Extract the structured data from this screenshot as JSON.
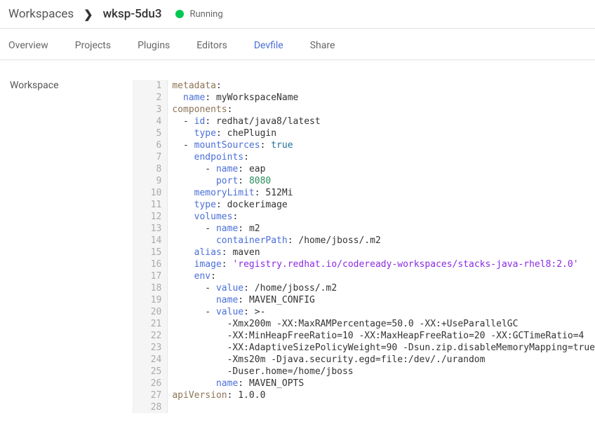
{
  "header": {
    "title": "Workspaces",
    "chevron": "❯",
    "workspace_id": "wksp-5du3",
    "status": "Running"
  },
  "tabs": [
    {
      "label": "Overview",
      "active": false
    },
    {
      "label": "Projects",
      "active": false
    },
    {
      "label": "Plugins",
      "active": false
    },
    {
      "label": "Editors",
      "active": false
    },
    {
      "label": "Devfile",
      "active": true
    },
    {
      "label": "Share",
      "active": false
    }
  ],
  "sidebar": {
    "label": "Workspace"
  },
  "code": {
    "lines": [
      [
        {
          "t": "key",
          "v": "metadata"
        },
        {
          "t": "punct",
          "v": ":"
        }
      ],
      [
        {
          "t": "plain",
          "v": "  "
        },
        {
          "t": "bkey",
          "v": "name"
        },
        {
          "t": "punct",
          "v": ": "
        },
        {
          "t": "val",
          "v": "myWorkspaceName"
        }
      ],
      [
        {
          "t": "key",
          "v": "components"
        },
        {
          "t": "punct",
          "v": ":"
        }
      ],
      [
        {
          "t": "plain",
          "v": "  - "
        },
        {
          "t": "bkey",
          "v": "id"
        },
        {
          "t": "punct",
          "v": ": "
        },
        {
          "t": "val",
          "v": "redhat/java8/latest"
        }
      ],
      [
        {
          "t": "plain",
          "v": "    "
        },
        {
          "t": "bkey",
          "v": "type"
        },
        {
          "t": "punct",
          "v": ": "
        },
        {
          "t": "val",
          "v": "chePlugin"
        }
      ],
      [
        {
          "t": "plain",
          "v": "  - "
        },
        {
          "t": "bkey",
          "v": "mountSources"
        },
        {
          "t": "punct",
          "v": ": "
        },
        {
          "t": "bool",
          "v": "true"
        }
      ],
      [
        {
          "t": "plain",
          "v": "    "
        },
        {
          "t": "bkey",
          "v": "endpoints"
        },
        {
          "t": "punct",
          "v": ":"
        }
      ],
      [
        {
          "t": "plain",
          "v": "      - "
        },
        {
          "t": "bkey",
          "v": "name"
        },
        {
          "t": "punct",
          "v": ": "
        },
        {
          "t": "val",
          "v": "eap"
        }
      ],
      [
        {
          "t": "plain",
          "v": "        "
        },
        {
          "t": "bkey",
          "v": "port"
        },
        {
          "t": "punct",
          "v": ": "
        },
        {
          "t": "num",
          "v": "8080"
        }
      ],
      [
        {
          "t": "plain",
          "v": "    "
        },
        {
          "t": "bkey",
          "v": "memoryLimit"
        },
        {
          "t": "punct",
          "v": ": "
        },
        {
          "t": "val",
          "v": "512Mi"
        }
      ],
      [
        {
          "t": "plain",
          "v": "    "
        },
        {
          "t": "bkey",
          "v": "type"
        },
        {
          "t": "punct",
          "v": ": "
        },
        {
          "t": "val",
          "v": "dockerimage"
        }
      ],
      [
        {
          "t": "plain",
          "v": "    "
        },
        {
          "t": "bkey",
          "v": "volumes"
        },
        {
          "t": "punct",
          "v": ":"
        }
      ],
      [
        {
          "t": "plain",
          "v": "      - "
        },
        {
          "t": "bkey",
          "v": "name"
        },
        {
          "t": "punct",
          "v": ": "
        },
        {
          "t": "val",
          "v": "m2"
        }
      ],
      [
        {
          "t": "plain",
          "v": "        "
        },
        {
          "t": "bkey",
          "v": "containerPath"
        },
        {
          "t": "punct",
          "v": ": "
        },
        {
          "t": "val",
          "v": "/home/jboss/.m2"
        }
      ],
      [
        {
          "t": "plain",
          "v": "    "
        },
        {
          "t": "bkey",
          "v": "alias"
        },
        {
          "t": "punct",
          "v": ": "
        },
        {
          "t": "val",
          "v": "maven"
        }
      ],
      [
        {
          "t": "plain",
          "v": "    "
        },
        {
          "t": "bkey",
          "v": "image"
        },
        {
          "t": "punct",
          "v": ": "
        },
        {
          "t": "str",
          "v": "'registry.redhat.io/codeready-workspaces/stacks-java-rhel8:2.0'"
        }
      ],
      [
        {
          "t": "plain",
          "v": "    "
        },
        {
          "t": "bkey",
          "v": "env"
        },
        {
          "t": "punct",
          "v": ":"
        }
      ],
      [
        {
          "t": "plain",
          "v": "      - "
        },
        {
          "t": "bkey",
          "v": "value"
        },
        {
          "t": "punct",
          "v": ": "
        },
        {
          "t": "val",
          "v": "/home/jboss/.m2"
        }
      ],
      [
        {
          "t": "plain",
          "v": "        "
        },
        {
          "t": "bkey",
          "v": "name"
        },
        {
          "t": "punct",
          "v": ": "
        },
        {
          "t": "val",
          "v": "MAVEN_CONFIG"
        }
      ],
      [
        {
          "t": "plain",
          "v": "      - "
        },
        {
          "t": "bkey",
          "v": "value"
        },
        {
          "t": "punct",
          "v": ": "
        },
        {
          "t": "val",
          "v": ">-"
        }
      ],
      [
        {
          "t": "plain",
          "v": "          -Xmx200m -XX:MaxRAMPercentage=50.0 -XX:+UseParallelGC"
        }
      ],
      [
        {
          "t": "plain",
          "v": "          -XX:MinHeapFreeRatio=10 -XX:MaxHeapFreeRatio=20 -XX:GCTimeRatio=4"
        }
      ],
      [
        {
          "t": "plain",
          "v": "          -XX:AdaptiveSizePolicyWeight=90 -Dsun.zip.disableMemoryMapping=true"
        }
      ],
      [
        {
          "t": "plain",
          "v": "          -Xms20m -Djava.security.egd=file:/dev/./urandom"
        }
      ],
      [
        {
          "t": "plain",
          "v": "          -Duser.home=/home/jboss"
        }
      ],
      [
        {
          "t": "plain",
          "v": "        "
        },
        {
          "t": "bkey",
          "v": "name"
        },
        {
          "t": "punct",
          "v": ": "
        },
        {
          "t": "val",
          "v": "MAVEN_OPTS"
        }
      ],
      [
        {
          "t": "key",
          "v": "apiVersion"
        },
        {
          "t": "punct",
          "v": ": "
        },
        {
          "t": "val",
          "v": "1.0.0"
        }
      ],
      [
        {
          "t": "plain",
          "v": ""
        }
      ]
    ]
  }
}
